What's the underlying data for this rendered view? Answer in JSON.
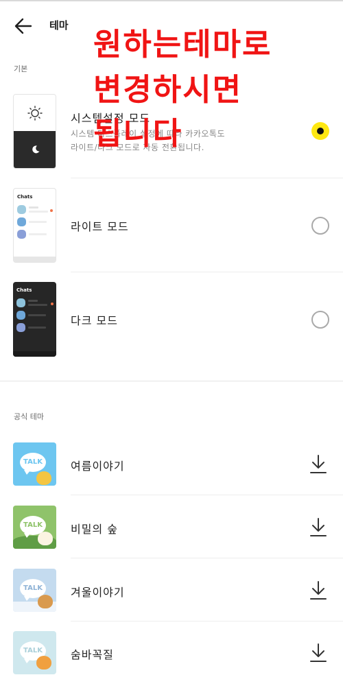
{
  "header": {
    "title": "테마"
  },
  "sections": {
    "basic_label": "기본",
    "official_label": "공식 테마"
  },
  "basic_rows": {
    "system": {
      "label": "시스템설정 모드",
      "desc_line1": "시스템 디스플레이 설정에 따라 카카오톡도",
      "desc_line2": "라이트/다크 모드로 자동 전환됩니다.",
      "selected": true
    },
    "light": {
      "label": "라이트 모드",
      "thumb_title": "Chats",
      "selected": false
    },
    "dark": {
      "label": "다크 모드",
      "thumb_title": "Chats",
      "selected": false
    }
  },
  "official_themes": {
    "summer": {
      "label": "여름이야기",
      "talk": "TALK"
    },
    "secret": {
      "label": "비밀의 숲",
      "talk": "TALK"
    },
    "winter": {
      "label": "겨울이야기",
      "talk": "TALK"
    },
    "hide": {
      "label": "숨바꼭질",
      "talk": "TALK"
    }
  },
  "overlay": {
    "line1": "원하는테마로",
    "line2": "변경하시면",
    "line3": "됩니다"
  },
  "colors": {
    "accent_yellow": "#ffe812",
    "overlay_red": "#f01414",
    "summer_bg": "#6dc6f0",
    "secret_bg": "#8fc36a",
    "winter_bg": "#c4dbef",
    "hide_bg": "#cfe8ee"
  },
  "icons": {
    "back": "arrow-left-icon",
    "sun": "sun-icon",
    "moon": "moon-icon",
    "download": "download-icon"
  }
}
